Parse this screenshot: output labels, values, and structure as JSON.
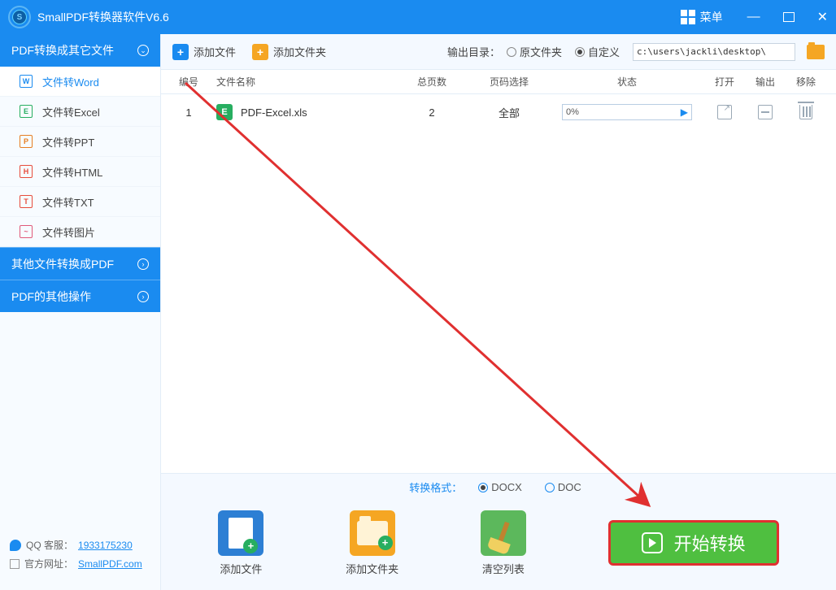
{
  "titlebar": {
    "title": "SmallPDF转换器软件V6.6",
    "menu": "菜单"
  },
  "sidebar": {
    "groups": [
      {
        "label": "PDF转换成其它文件",
        "expanded": true
      },
      {
        "label": "其他文件转换成PDF",
        "expanded": false
      },
      {
        "label": "PDF的其他操作",
        "expanded": false
      }
    ],
    "items": [
      {
        "label": "文件转Word"
      },
      {
        "label": "文件转Excel"
      },
      {
        "label": "文件转PPT"
      },
      {
        "label": "文件转HTML"
      },
      {
        "label": "文件转TXT"
      },
      {
        "label": "文件转图片"
      }
    ],
    "footer": {
      "qq_label": "QQ 客服：",
      "qq_value": "1933175230",
      "site_label": "官方网址：",
      "site_value": "SmallPDF.com"
    }
  },
  "toolbar": {
    "add_file": "添加文件",
    "add_folder": "添加文件夹",
    "output_label": "输出目录：",
    "opt_original": "原文件夹",
    "opt_custom": "自定义",
    "path": "c:\\users\\jackli\\desktop\\"
  },
  "table": {
    "headers": {
      "idx": "编号",
      "name": "文件名称",
      "pages": "总页数",
      "sel": "页码选择",
      "status": "状态",
      "open": "打开",
      "out": "输出",
      "del": "移除"
    },
    "rows": [
      {
        "idx": "1",
        "name": "PDF-Excel.xls",
        "pages": "2",
        "sel": "全部",
        "progress": "0%"
      }
    ]
  },
  "format": {
    "label": "转换格式：",
    "opt1": "DOCX",
    "opt2": "DOC"
  },
  "actions": {
    "add_file": "添加文件",
    "add_folder": "添加文件夹",
    "clear": "清空列表",
    "start": "开始转换"
  }
}
